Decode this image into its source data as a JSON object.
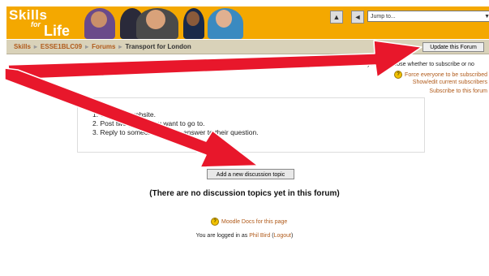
{
  "header": {
    "logo": {
      "line1": "Skills",
      "line2": "for",
      "line3": "Life"
    },
    "jump_label": "Jump to...",
    "nav_prev_icon": "back-arrow-icon",
    "nav_up_icon": "up-icon"
  },
  "navbar": {
    "breadcrumb": [
      "Skills",
      "ESSE1BLC09",
      "Forums",
      "Transport for London"
    ],
    "separator": "▸",
    "update_button": "Update this Forum"
  },
  "subscription": {
    "info": "This forum allows everyone to choose whether to subscribe or no",
    "force_link": "Force everyone to be subscribed",
    "show_edit_link": "Show/edit current subscribers",
    "subscribe_link": "Subscribe to this forum"
  },
  "instructions": [
    "1.  Open the website.",
    "2.  Post two places you want to go to.",
    "3.  Reply to someone with the answer to their question."
  ],
  "add_topic_button": "Add a new discussion topic",
  "no_topics": "(There are no discussion topics yet in this forum)",
  "moodle_docs": "Moodle Docs for this page",
  "footer": {
    "prefix": "You are logged in as",
    "user": "Phil Bird",
    "logout": "Logout"
  },
  "colors": {
    "header": "#f4a800",
    "navbar": "#d9d2b9",
    "link": "#b05a1a",
    "annotation_arrow": "#e8172b"
  }
}
